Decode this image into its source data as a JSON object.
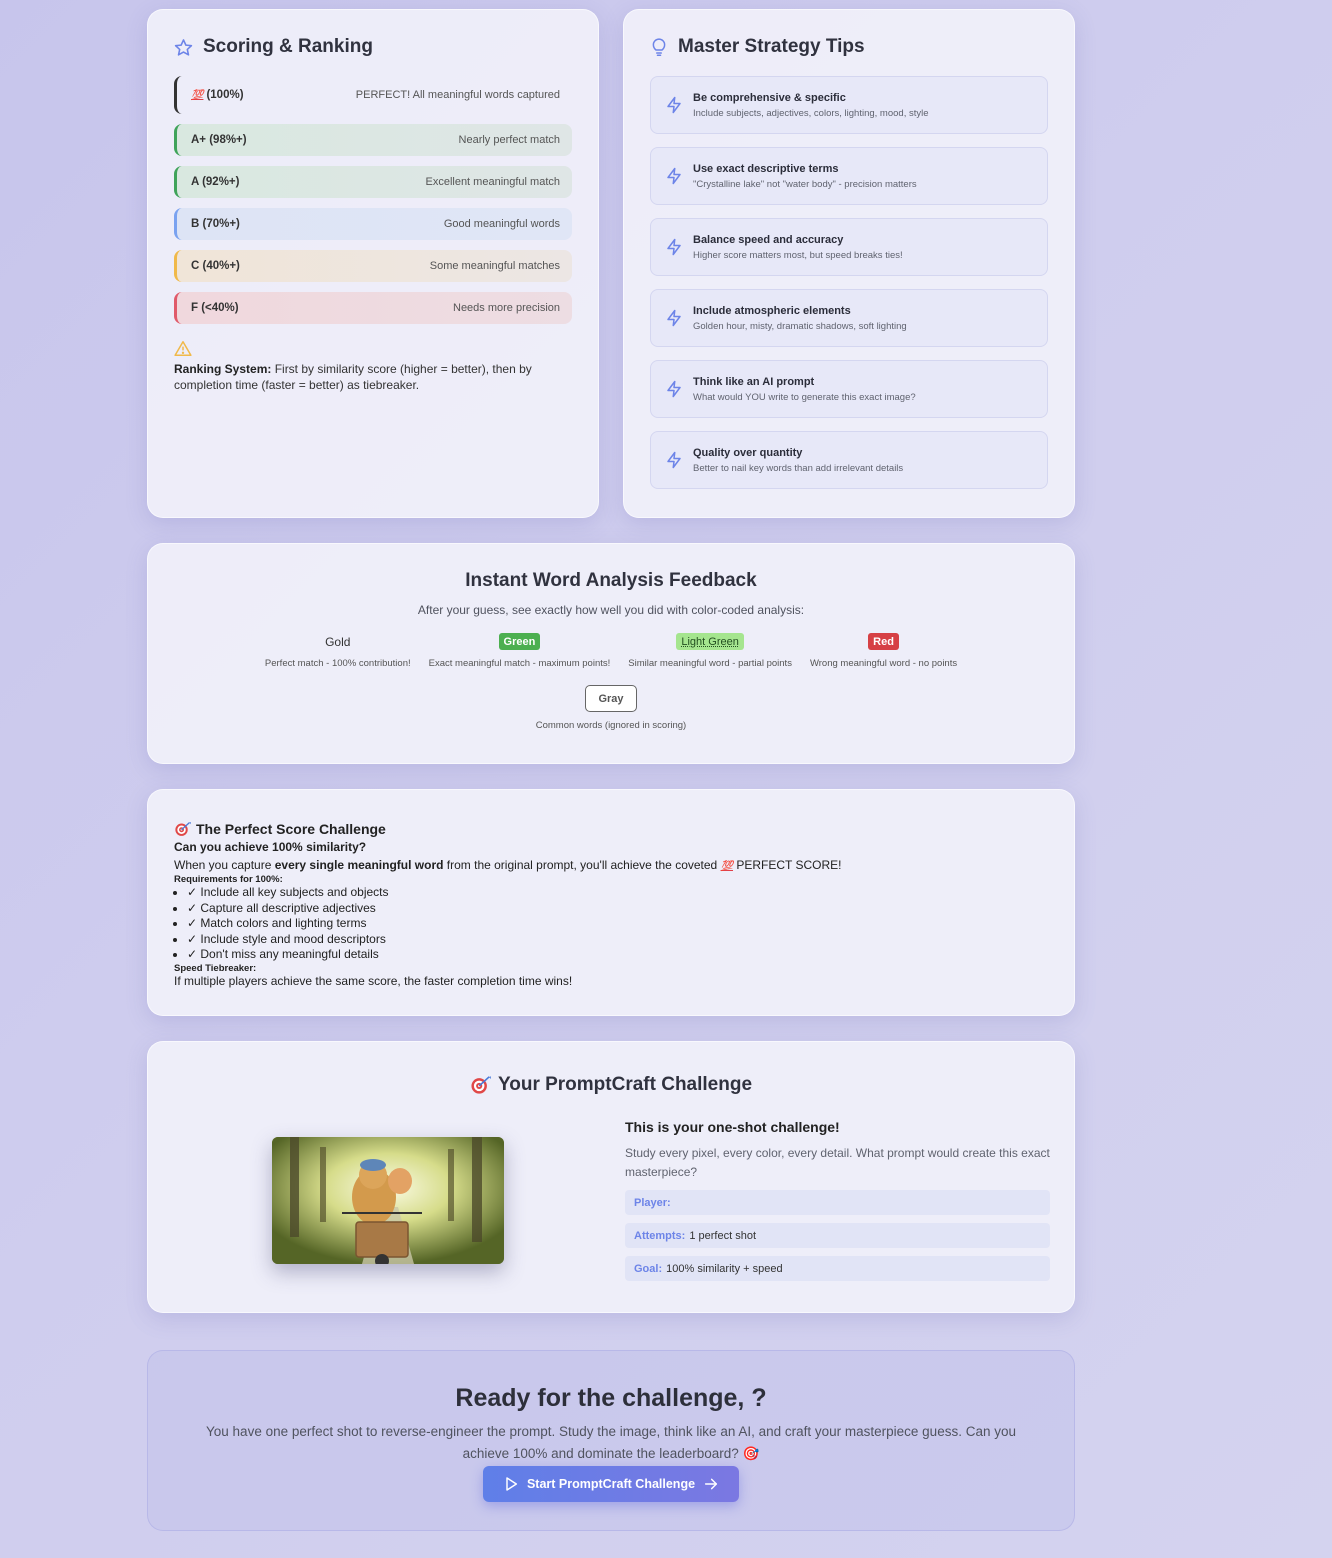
{
  "scoring": {
    "title": "Scoring & Ranking",
    "grades": [
      {
        "label": "(100%)",
        "desc": "PERFECT! All meaningful words captured",
        "prefix": "💯"
      },
      {
        "label": "A+ (98%+)",
        "desc": "Nearly perfect match"
      },
      {
        "label": "A (92%+)",
        "desc": "Excellent meaningful match"
      },
      {
        "label": "B (70%+)",
        "desc": "Good meaningful words"
      },
      {
        "label": "C (40%+)",
        "desc": "Some meaningful matches"
      },
      {
        "label": "F (<40%)",
        "desc": "Needs more precision"
      }
    ],
    "note_bold": "Ranking System:",
    "note_text": " First by similarity score (higher = better), then by completion time (faster = better) as tiebreaker."
  },
  "tips": {
    "title": "Master Strategy Tips",
    "items": [
      {
        "title": "Be comprehensive & specific",
        "desc": "Include subjects, adjectives, colors, lighting, mood, style"
      },
      {
        "title": "Use exact descriptive terms",
        "desc": "\"Crystalline lake\" not \"water body\" - precision matters"
      },
      {
        "title": "Balance speed and accuracy",
        "desc": "Higher score matters most, but speed breaks ties!"
      },
      {
        "title": "Include atmospheric elements",
        "desc": "Golden hour, misty, dramatic shadows, soft lighting"
      },
      {
        "title": "Think like an AI prompt",
        "desc": "What would YOU write to generate this exact image?"
      },
      {
        "title": "Quality over quantity",
        "desc": "Better to nail key words than add irrelevant details"
      }
    ]
  },
  "feedback": {
    "title": "Instant Word Analysis Feedback",
    "subtitle": "After your guess, see exactly how well you did with color-coded analysis:",
    "legend": [
      {
        "chip": "Gold",
        "desc": "Perfect match - 100% contribution!"
      },
      {
        "chip": "Green",
        "desc": "Exact meaningful match - maximum points!"
      },
      {
        "chip": "Light Green",
        "desc": "Similar meaningful word - partial points"
      },
      {
        "chip": "Red",
        "desc": "Wrong meaningful word - no points"
      },
      {
        "chip": "Gray",
        "desc": "Common words (ignored in scoring)"
      }
    ]
  },
  "perfect": {
    "title": "The Perfect Score Challenge",
    "question": "Can you achieve 100% similarity?",
    "body_pre": "When you capture ",
    "body_bold": "every single meaningful word",
    "body_post": " from the original prompt, you'll achieve the coveted ",
    "body_end": " PERFECT SCORE!",
    "hundred": "💯",
    "req_title": "Requirements for 100%:",
    "requirements": [
      "✓ Include all key subjects and objects",
      "✓ Capture all descriptive adjectives",
      "✓ Match colors and lighting terms",
      "✓ Include style and mood descriptors",
      "✓ Don't miss any meaningful details"
    ],
    "tie_title": "Speed Tiebreaker:",
    "tie_text": "If multiple players achieve the same score, the faster completion time wins!"
  },
  "challenge": {
    "title": "Your PromptCraft Challenge",
    "heading": "This is your one-shot challenge!",
    "desc": "Study every pixel, every color, every detail. What prompt would create this exact masterpiece?",
    "rows": [
      {
        "key": "Player:",
        "value": ""
      },
      {
        "key": "Attempts:",
        "value": "1 perfect shot"
      },
      {
        "key": "Goal:",
        "value": "100% similarity + speed"
      }
    ]
  },
  "ready": {
    "title": "Ready for the challenge, ?",
    "desc": "You have one perfect shot to reverse-engineer the prompt. Study the image, think like an AI, and craft your masterpiece guess. Can you achieve 100% and dominate the leaderboard? 🎯",
    "button": "Start PromptCraft Challenge"
  },
  "colors": {
    "accent": "#6d84e8",
    "green": "#4caf50",
    "light_green": "#a5e58f",
    "red": "#d64045",
    "warning": "#f0b94a"
  }
}
